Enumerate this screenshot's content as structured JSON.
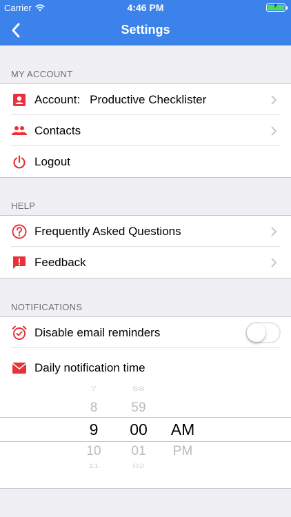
{
  "status_bar": {
    "carrier": "Carrier",
    "time": "4:46 PM"
  },
  "nav": {
    "title": "Settings",
    "back_icon": "chevron-left-icon"
  },
  "sections": {
    "account": {
      "header": "MY ACCOUNT",
      "account_label": "Account:",
      "account_value": "Productive Checklister",
      "contacts_label": "Contacts",
      "logout_label": "Logout"
    },
    "help": {
      "header": "HELP",
      "faq_label": "Frequently Asked Questions",
      "feedback_label": "Feedback"
    },
    "notifications": {
      "header": "NOTIFICATIONS",
      "disable_email_label": "Disable email reminders",
      "disable_email_on": false,
      "daily_time_label": "Daily notification time"
    }
  },
  "picker": {
    "hours": [
      "7",
      "8",
      "9",
      "10",
      "11"
    ],
    "minutes": [
      "58",
      "59",
      "00",
      "01",
      "02"
    ],
    "periods": [
      "AM",
      "PM"
    ],
    "selected": {
      "hour": "9",
      "minute": "00",
      "period": "AM"
    }
  },
  "colors": {
    "accent": "#3b82ea",
    "icon_red": "#e8313a",
    "separator": "#c8c7cc"
  }
}
